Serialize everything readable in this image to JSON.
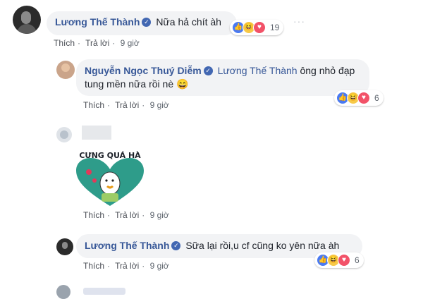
{
  "comments": [
    {
      "author": "Lương Thế Thành",
      "text": "Nữa hả chít àh",
      "reaction_count": "19",
      "like_label": "Thích",
      "reply_label": "Trả lời",
      "time": "9 giờ",
      "menu_icon": "more-dots-icon"
    },
    {
      "author": "Nguyễn Ngọc Thuý Diễm",
      "mention": "Lương Thế Thành",
      "text_line1": "ông nhỏ đạp",
      "text_line2": "tung mền nữa rồi nè 😄",
      "reaction_count": "6",
      "like_label": "Thích",
      "reply_label": "Trả lời",
      "time": "9 giờ"
    },
    {
      "sticker_text": "CƯNG QUÁ HÀ",
      "like_label": "Thích",
      "reply_label": "Trả lời",
      "time": "9 giờ"
    },
    {
      "author": "Lương Thế Thành",
      "text": "Sữa lại rồi,u cf cũng ko yên nữa àh",
      "reaction_count": "6",
      "like_label": "Thích",
      "reply_label": "Trả lời",
      "time": "9 giờ"
    }
  ],
  "reactions": [
    "like",
    "haha",
    "love"
  ],
  "colors": {
    "name": "#385898",
    "bubble": "#f2f3f5",
    "verified": "#4267b2",
    "sticker_heart": "#2e9c8a"
  }
}
